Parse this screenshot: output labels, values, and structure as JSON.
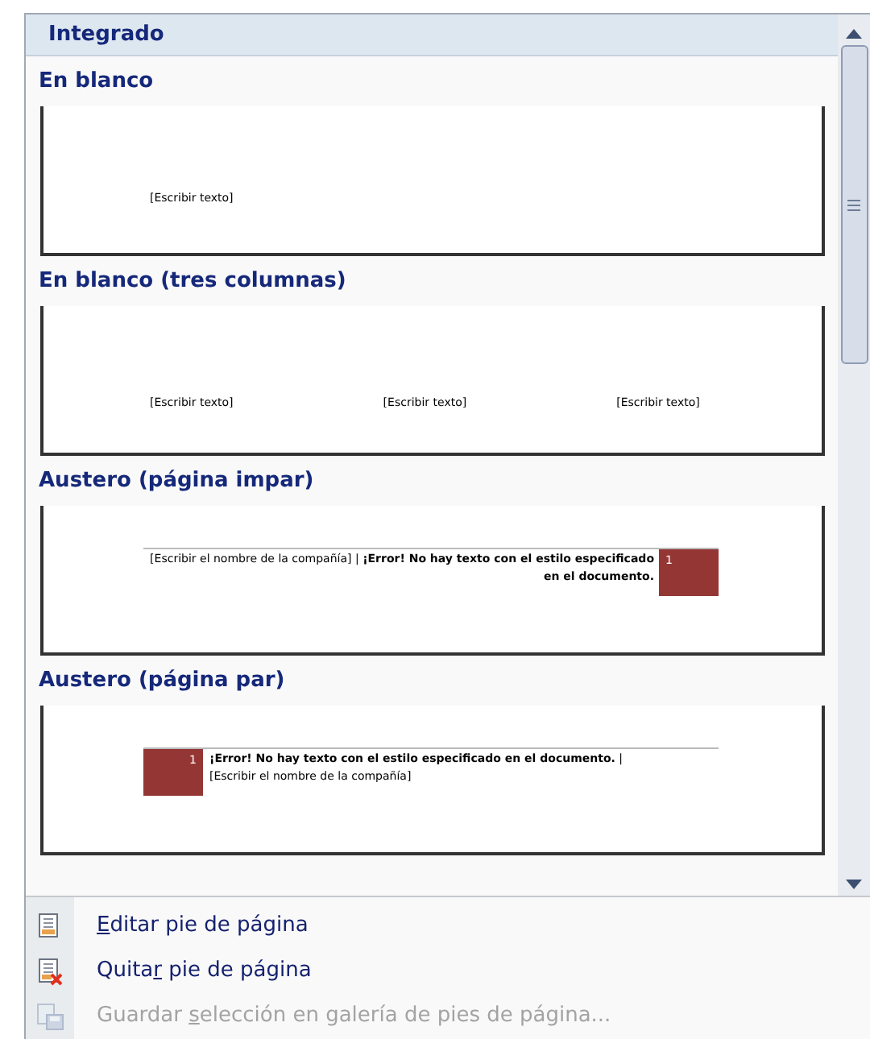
{
  "gallery": {
    "category": "Integrado",
    "items": [
      {
        "kind": "blank",
        "title": "En blanco",
        "texts": [
          "[Escribir texto]"
        ]
      },
      {
        "kind": "three_columns",
        "title": "En blanco (tres columnas)",
        "texts": [
          "[Escribir texto]",
          "[Escribir texto]",
          "[Escribir texto]"
        ]
      },
      {
        "kind": "austere_odd",
        "title": "Austero (página impar)",
        "texts": [
          "[Escribir el nombre de la compañía] | **¡Error! No hay texto con el estilo especificado en el documento.**"
        ],
        "page_number": "1"
      },
      {
        "kind": "austere_even",
        "title": "Austero (página par)",
        "texts": [
          "**¡Error! No hay texto con el estilo especificado en el documento.** | [Escribir el nombre de la compañía]"
        ],
        "page_number": "1"
      }
    ]
  },
  "menu": [
    {
      "kind": "edit",
      "access_key": "E",
      "label_after": "ditar pie de página",
      "disabled": false
    },
    {
      "kind": "remove",
      "label_before": "Quita",
      "access_key": "r",
      "label_after": " pie de página",
      "disabled": false
    },
    {
      "kind": "save",
      "label_before": "Guardar ",
      "access_key": "s",
      "label_after": "elección en galería de pies de página...",
      "disabled": true
    }
  ]
}
